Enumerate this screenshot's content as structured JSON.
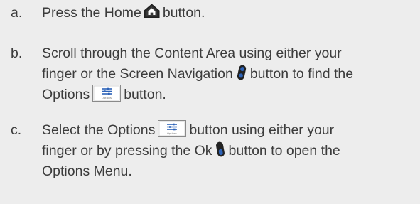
{
  "steps": [
    {
      "letter": "a.",
      "lines": [
        {
          "before": "Press the Home",
          "icon": "home-icon",
          "after": "button."
        }
      ]
    },
    {
      "letter": "b.",
      "lines": [
        {
          "text": "Scroll through the Content Area using either your"
        },
        {
          "before": "finger or the Screen Navigation",
          "icon": "screen-navigation-icon",
          "after": "button to find the"
        },
        {
          "before": "Options",
          "icon": "options-icon",
          "after": "button."
        }
      ]
    },
    {
      "letter": "c.",
      "lines": [
        {
          "before": "Select the Options",
          "icon": "options-icon",
          "after": "button using either your"
        },
        {
          "before": "finger or by pressing the Ok",
          "icon": "ok-icon",
          "after": "button to open the"
        },
        {
          "text": "Options Menu."
        }
      ]
    }
  ],
  "options_icon_caption": "Options",
  "colors": {
    "text": "#3c3c3c",
    "background": "#ededed",
    "icon_dark": "#2a2a2a",
    "icon_accent": "#2d63b8",
    "icon_frame": "#8a8a8a"
  }
}
